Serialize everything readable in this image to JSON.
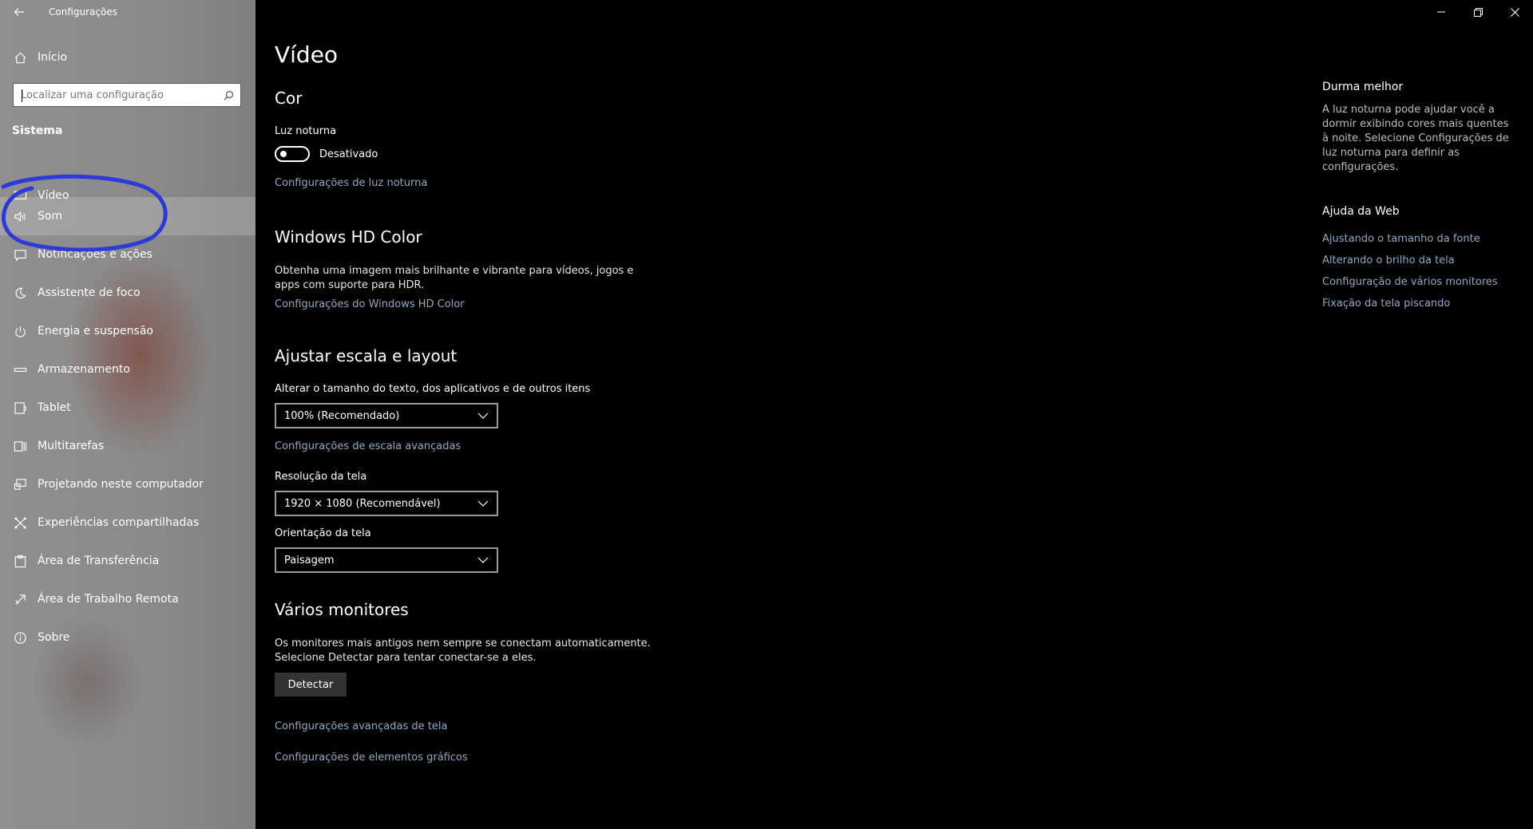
{
  "window": {
    "title": "Configurações",
    "back_icon": "back-arrow-icon",
    "controls": [
      "minimize-icon",
      "restore-icon",
      "close-icon"
    ]
  },
  "sidebar": {
    "home_label": "Início",
    "search_placeholder": "Localizar uma configuração",
    "section_title": "Sistema",
    "items": [
      {
        "label": "Vídeo",
        "icon": "monitor-icon"
      },
      {
        "label": "Som",
        "icon": "speaker-icon"
      },
      {
        "label": "Notificações e ações",
        "icon": "notification-icon"
      },
      {
        "label": "Assistente de foco",
        "icon": "moon-icon"
      },
      {
        "label": "Energia e suspensão",
        "icon": "power-icon"
      },
      {
        "label": "Armazenamento",
        "icon": "storage-icon"
      },
      {
        "label": "Tablet",
        "icon": "tablet-icon"
      },
      {
        "label": "Multitarefas",
        "icon": "multitask-icon"
      },
      {
        "label": "Projetando neste computador",
        "icon": "projector-icon"
      },
      {
        "label": "Experiências compartilhadas",
        "icon": "shared-icon"
      },
      {
        "label": "Área de Transferência",
        "icon": "clipboard-icon"
      },
      {
        "label": "Área de Trabalho Remota",
        "icon": "remote-icon"
      },
      {
        "label": "Sobre",
        "icon": "info-icon"
      }
    ],
    "annotation_color": "#2e3ad6"
  },
  "main": {
    "title": "Vídeo",
    "color_section": {
      "heading": "Cor",
      "night_light_label": "Luz noturna",
      "toggle_state": "Desativado",
      "night_light_link": "Configurações de luz noturna"
    },
    "hdr_section": {
      "heading": "Windows HD Color",
      "description_line1": "Obtenha uma imagem mais brilhante e vibrante para vídeos, jogos e",
      "description_line2": "apps com suporte para HDR.",
      "link": "Configurações do Windows HD Color"
    },
    "scale_section": {
      "heading": "Ajustar escala e layout",
      "scale_label": "Alterar o tamanho do texto, dos aplicativos e de outros itens",
      "scale_value": "100% (Recomendado)",
      "scale_link": "Configurações de escala avançadas",
      "resolution_label": "Resolução da tela",
      "resolution_value": "1920 × 1080 (Recomendável)",
      "orientation_label": "Orientação da tela",
      "orientation_value": "Paisagem"
    },
    "monitors_section": {
      "heading": "Vários monitores",
      "description_line1": "Os monitores mais antigos nem sempre se conectam automaticamente.",
      "description_line2": "Selecione Detectar para tentar conectar-se a eles.",
      "detect_button": "Detectar",
      "advanced_link": "Configurações avançadas de tela",
      "graphics_link": "Configurações de elementos gráficos"
    }
  },
  "right_panel": {
    "sleep_heading": "Durma melhor",
    "sleep_desc": "A luz noturna pode ajudar você a dormir exibindo cores mais quentes à noite. Selecione Configurações de luz noturna para definir as configurações.",
    "help_heading": "Ajuda da Web",
    "help_links": [
      "Ajustando o tamanho da fonte",
      "Alterando o brilho da tela",
      "Configuração de vários monitores",
      "Fixação da tela piscando"
    ]
  },
  "colors": {
    "link": "#8ea9c3",
    "background": "#000000",
    "sidebar": "#8c8c8c"
  }
}
